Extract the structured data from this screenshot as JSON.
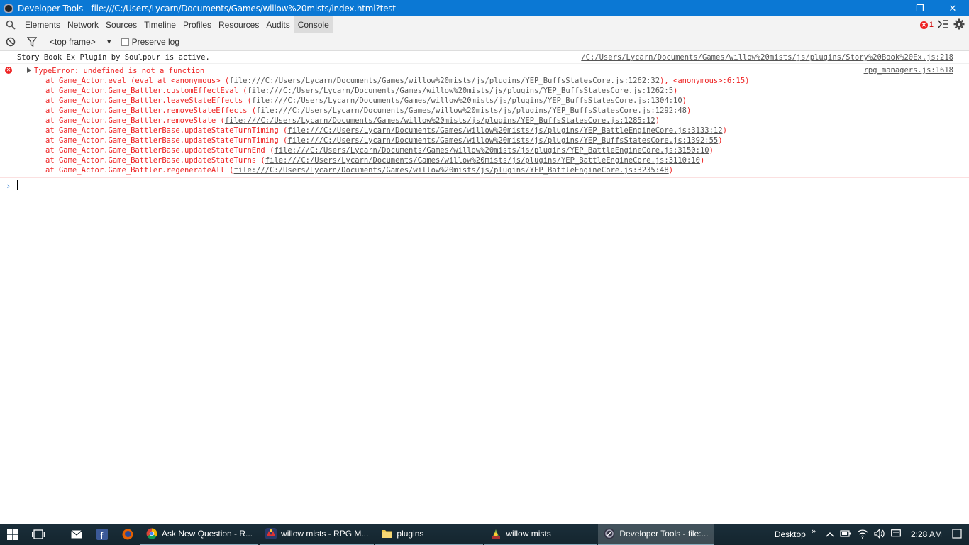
{
  "window": {
    "title": "Developer Tools - file:///C:/Users/Lycarn/Documents/Games/willow%20mists/index.html?test",
    "minimize": "—",
    "restore": "❐",
    "close": "✕"
  },
  "tabs": [
    {
      "label": "Elements"
    },
    {
      "label": "Network"
    },
    {
      "label": "Sources"
    },
    {
      "label": "Timeline"
    },
    {
      "label": "Profiles"
    },
    {
      "label": "Resources"
    },
    {
      "label": "Audits"
    },
    {
      "label": "Console"
    }
  ],
  "error_count": "1",
  "toolbar": {
    "frame": "<top frame>",
    "preserve_log": "Preserve log"
  },
  "console": {
    "info": {
      "text": "Story Book Ex Plugin by Soulpour is active.",
      "source": "/C:/Users/Lycarn/Documents/Games/willow%20mists/js/plugins/Story%20Book%20Ex.js:218"
    },
    "error": {
      "message": "TypeError: undefined is not a function",
      "source": "rpg_managers.js:1618",
      "stack": [
        {
          "at": "at Game_Actor.eval (eval at <anonymous> (",
          "link": "file:///C:/Users/Lycarn/Documents/Games/willow%20mists/js/plugins/YEP_BuffsStatesCore.js:1262:32",
          "tail": "), <anonymous>:6:15)"
        },
        {
          "at": "at Game_Actor.Game_Battler.customEffectEval (",
          "link": "file:///C:/Users/Lycarn/Documents/Games/willow%20mists/js/plugins/YEP_BuffsStatesCore.js:1262:5",
          "tail": ")"
        },
        {
          "at": "at Game_Actor.Game_Battler.leaveStateEffects (",
          "link": "file:///C:/Users/Lycarn/Documents/Games/willow%20mists/js/plugins/YEP_BuffsStatesCore.js:1304:10",
          "tail": ")"
        },
        {
          "at": "at Game_Actor.Game_Battler.removeStateEffects (",
          "link": "file:///C:/Users/Lycarn/Documents/Games/willow%20mists/js/plugins/YEP_BuffsStatesCore.js:1292:48",
          "tail": ")"
        },
        {
          "at": "at Game_Actor.Game_Battler.removeState (",
          "link": "file:///C:/Users/Lycarn/Documents/Games/willow%20mists/js/plugins/YEP_BuffsStatesCore.js:1285:12",
          "tail": ")"
        },
        {
          "at": "at Game_Actor.Game_BattlerBase.updateStateTurnTiming (",
          "link": "file:///C:/Users/Lycarn/Documents/Games/willow%20mists/js/plugins/YEP_BattleEngineCore.js:3133:12",
          "tail": ")"
        },
        {
          "at": "at Game_Actor.Game_BattlerBase.updateStateTurnTiming (",
          "link": "file:///C:/Users/Lycarn/Documents/Games/willow%20mists/js/plugins/YEP_BuffsStatesCore.js:1392:55",
          "tail": ")"
        },
        {
          "at": "at Game_Actor.Game_BattlerBase.updateStateTurnEnd (",
          "link": "file:///C:/Users/Lycarn/Documents/Games/willow%20mists/js/plugins/YEP_BattleEngineCore.js:3150:10",
          "tail": ")"
        },
        {
          "at": "at Game_Actor.Game_BattlerBase.updateStateTurns (",
          "link": "file:///C:/Users/Lycarn/Documents/Games/willow%20mists/js/plugins/YEP_BattleEngineCore.js:3110:10",
          "tail": ")"
        },
        {
          "at": "at Game_Actor.Game_Battler.regenerateAll (",
          "link": "file:///C:/Users/Lycarn/Documents/Games/willow%20mists/js/plugins/YEP_BattleEngineCore.js:3235:48",
          "tail": ")"
        }
      ]
    },
    "prompt": "›"
  },
  "taskbar": {
    "apps": [
      {
        "label": "Ask New Question - R...",
        "icon": "chrome-icon",
        "color": "#e8a317"
      },
      {
        "label": "willow mists - RPG M...",
        "icon": "rpgmaker-icon",
        "color": "#c33"
      },
      {
        "label": "plugins",
        "icon": "folder-icon",
        "color": "#f2c94c"
      },
      {
        "label": "willow mists",
        "icon": "game-icon",
        "color": "#7a4"
      },
      {
        "label": "Developer Tools - file:...",
        "icon": "devtools-icon",
        "color": "#556"
      }
    ],
    "desktop": "Desktop",
    "time": "2:28 AM"
  }
}
